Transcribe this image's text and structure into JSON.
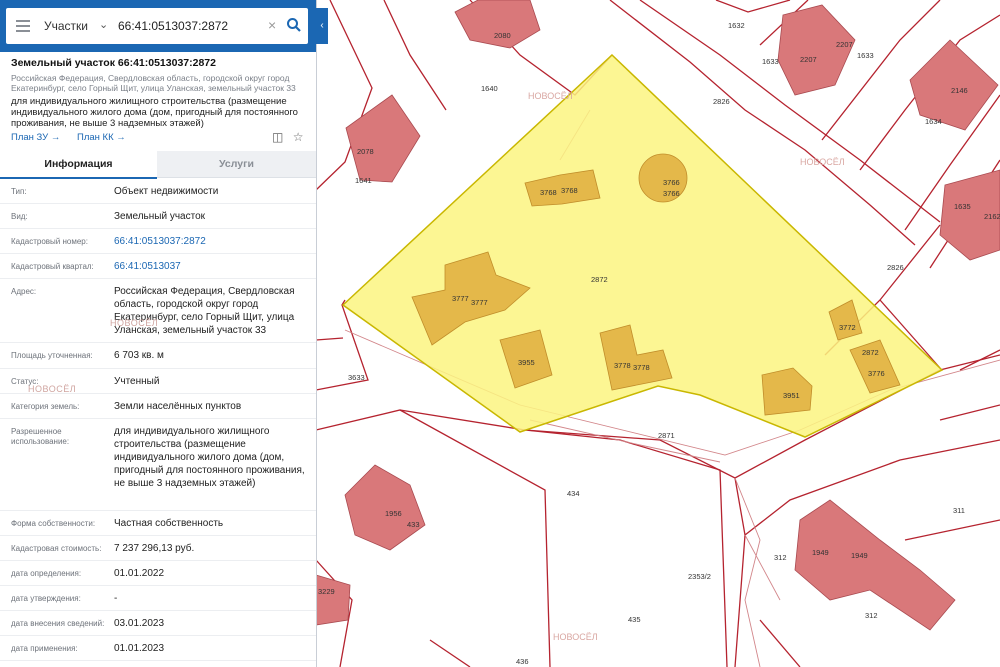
{
  "search": {
    "type_label": "Участки",
    "query": "66:41:0513037:2872"
  },
  "header": {
    "title": "Земельный участок 66:41:0513037:2872",
    "address": "Российская Федерация, Свердловская область, городской округ город Екатеринбург, село Горный Щит, улица Уланская, земельный участок 33",
    "usage": "для индивидуального жилищного строительства (размещение индивидуального жилого дома (дом, пригодный для постоянного проживания, не выше 3 надземных этажей)",
    "link_zu": "План ЗУ →",
    "link_kk": "План КК →"
  },
  "tabs": {
    "info": "Информация",
    "services": "Услуги"
  },
  "rows": [
    {
      "label": "Тип:",
      "value": "Объект недвижимости"
    },
    {
      "label": "Вид:",
      "value": "Земельный участок"
    },
    {
      "label": "Кадастровый номер:",
      "value": "66:41:0513037:2872"
    },
    {
      "label": "Кадастровый квартал:",
      "value": "66:41:0513037"
    },
    {
      "label": "Адрес:",
      "value": "Российская Федерация, Свердловская область, городской округ город Екатеринбург, село Горный Щит, улица Уланская, земельный участок 33"
    },
    {
      "label": "Площадь уточненная:",
      "value": "6 703 кв. м"
    },
    {
      "label": "Статус:",
      "value": "Учтенный"
    },
    {
      "label": "Категория земель:",
      "value": "Земли населённых пунктов"
    },
    {
      "label": "Разрешенное использование:",
      "value": "для индивидуального жилищного строительства (размещение индивидуального жилого дома (дом, пригодный для постоянного проживания, не выше 3 надземных этажей)"
    },
    {
      "label": "Форма собственности:",
      "value": "Частная собственность"
    },
    {
      "label": "Кадастровая стоимость:",
      "value": "7 237 296,13 руб."
    },
    {
      "label": "дата определения:",
      "value": "01.01.2022"
    },
    {
      "label": "дата утверждения:",
      "value": "-"
    },
    {
      "label": "дата внесения сведений:",
      "value": "03.01.2023"
    },
    {
      "label": "дата применения:",
      "value": "01.01.2023"
    }
  ],
  "map_labels": {
    "p2872": "2872",
    "p2871": "2871",
    "p2826": "2826",
    "p2826b": "2826",
    "p1632": "1632",
    "p1633": "1633",
    "p1633b": "1633",
    "p1640": "1640",
    "p1634": "1634",
    "p1635": "1635",
    "p3633": "3633",
    "p434": "434",
    "p435": "435",
    "p436": "436",
    "p311": "311",
    "p312": "312",
    "p312b": "312",
    "p2353": "2353/2",
    "b2080": "2080",
    "b2078": "2078",
    "b1641": "1641",
    "b2207": "2207",
    "b2207b": "2207",
    "b2146": "2146",
    "b2162": "2162",
    "b1956": "1956",
    "b433": "433",
    "b1949": "1949",
    "b1949b": "1949",
    "b3229": "3229",
    "y3768": "3768",
    "y3768b": "3768",
    "y3766": "3766",
    "y3766b": "3766",
    "y3777": "3777",
    "y3777b": "3777",
    "y3955": "3955",
    "y3778": "3778",
    "y3778b": "3778",
    "y3951": "3951",
    "y3772": "3772",
    "y2872": "2872",
    "y3776": "3776"
  },
  "watermark": "НОВОСЁЛ",
  "colors": {
    "accent": "#1b67b3",
    "parcel_fill": "#fbf580",
    "parcel_stroke": "#c9b700",
    "building": "#d9787a",
    "building_stroke": "#a94a50",
    "on_parcel_building": "#e4b84a",
    "boundary": "#b5232f"
  }
}
